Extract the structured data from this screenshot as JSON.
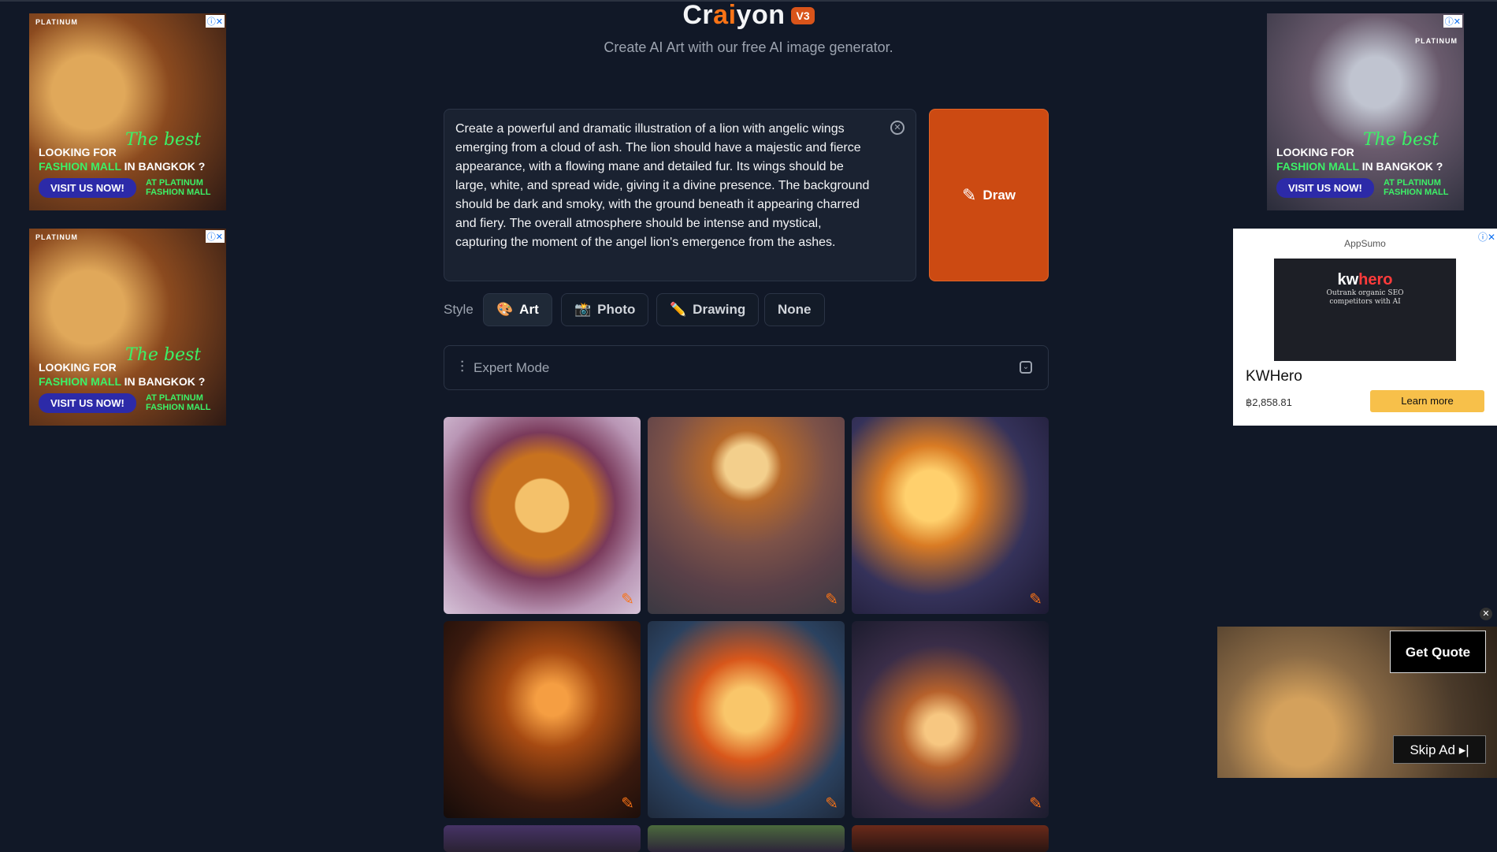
{
  "header": {
    "logo_pre": "Cr",
    "logo_ai": "ai",
    "logo_post": "yon",
    "version_badge": "V3",
    "subtitle": "Create AI Art with our free AI image generator."
  },
  "prompt": {
    "text": "Create a powerful and dramatic illustration of a lion with angelic wings emerging from a cloud of ash. The lion should have a majestic and fierce appearance, with a flowing mane and detailed fur. Its wings should be large, white, and spread wide, giving it a divine presence. The background should be dark and smoky, with the ground beneath it appearing charred and fiery. The overall atmosphere should be intense and mystical, capturing the moment of the angel lion's emergence from the ashes.",
    "draw_label": "Draw",
    "draw_icon": "pencil-icon"
  },
  "style": {
    "label": "Style",
    "options": [
      {
        "label": "Art",
        "icon": "🎨",
        "active": true
      },
      {
        "label": "Photo",
        "icon": "📸",
        "active": false
      },
      {
        "label": "Drawing",
        "icon": "✏️",
        "active": false
      },
      {
        "label": "None",
        "icon": "",
        "active": false
      }
    ]
  },
  "expert": {
    "label": "Expert Mode",
    "icon": "sliders-icon"
  },
  "results": {
    "images": [
      {
        "subject": "lion-portrait-1"
      },
      {
        "subject": "lion-standing"
      },
      {
        "subject": "lion-winged-profile"
      },
      {
        "subject": "lion-profile-fire"
      },
      {
        "subject": "lion-fiery-mane"
      },
      {
        "subject": "lion-winged-smoke"
      },
      {
        "subject": "partial-1"
      },
      {
        "subject": "partial-2"
      },
      {
        "subject": "partial-3"
      }
    ]
  },
  "ads": {
    "mall": {
      "brand": "PLATINUM",
      "line1": "LOOKING FOR",
      "line2_highlight": "FASHION MALL",
      "line2_rest": " IN BANGKOK ?",
      "script": "The best",
      "cta": "VISIT US NOW!",
      "location_1": "AT PLATINUM",
      "location_2": "FASHION MALL"
    },
    "appsumo": {
      "brand": "AppSumo",
      "product_logo_pre": "kw",
      "product_logo_highlight": "hero",
      "tagline_1": "Outrank organic SEO",
      "tagline_2": "competitors with AI",
      "title": "KWHero",
      "price": "฿2,858.81",
      "cta": "Learn more"
    },
    "video": {
      "quote_label": "Get Quote",
      "skip_label": "Skip Ad ▸|"
    }
  }
}
